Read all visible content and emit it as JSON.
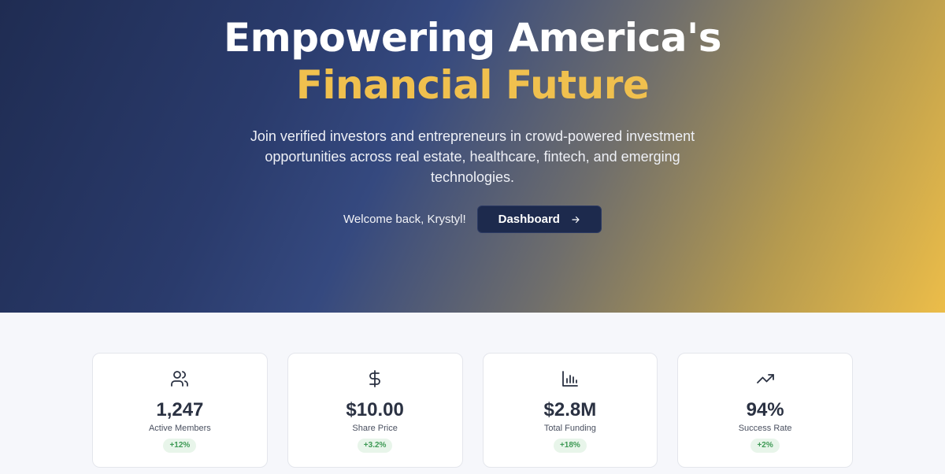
{
  "hero": {
    "title_line1": "Empowering America's",
    "title_line2": "Financial Future",
    "subtitle": "Join verified investors and entrepreneurs in crowd-powered investment opportunities across real estate, healthcare, fintech, and emerging technologies.",
    "welcome": "Welcome back, Krystyl!",
    "cta_label": "Dashboard",
    "accent_color": "#f0c04e"
  },
  "stats": [
    {
      "icon": "users-icon",
      "value": "1,247",
      "label": "Active Members",
      "change": "+12%"
    },
    {
      "icon": "dollar-icon",
      "value": "$10.00",
      "label": "Share Price",
      "change": "+3.2%"
    },
    {
      "icon": "bar-chart-icon",
      "value": "$2.8M",
      "label": "Total Funding",
      "change": "+18%"
    },
    {
      "icon": "trending-up-icon",
      "value": "94%",
      "label": "Success Rate",
      "change": "+2%"
    }
  ]
}
